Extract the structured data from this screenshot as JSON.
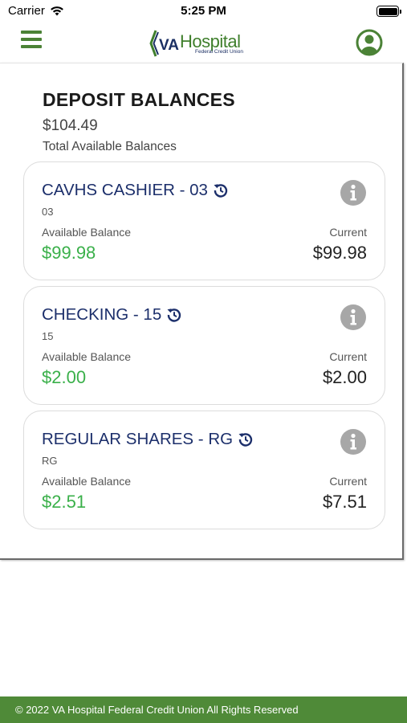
{
  "status_bar": {
    "carrier": "Carrier",
    "time": "5:25 PM"
  },
  "header": {
    "logo_main": "Hospital",
    "logo_badge": "VA",
    "logo_sub": "Federal Credit Union",
    "brand_color": "#4b8236",
    "navy_color": "#1c2f6b"
  },
  "balances": {
    "title": "DEPOSIT BALANCES",
    "total": "$104.49",
    "total_caption": "Total Available Balances"
  },
  "accounts": [
    {
      "name": "CAVHS CASHIER - 03",
      "code": "03",
      "available_label": "Available Balance",
      "available": "$99.98",
      "current_label": "Current",
      "current": "$99.98"
    },
    {
      "name": "CHECKING - 15",
      "code": "15",
      "available_label": "Available Balance",
      "available": "$2.00",
      "current_label": "Current",
      "current": "$2.00"
    },
    {
      "name": "REGULAR SHARES - RG",
      "code": "RG",
      "available_label": "Available Balance",
      "available": "$2.51",
      "current_label": "Current",
      "current": "$7.51"
    }
  ],
  "footer": {
    "copyright": "© 2022 VA Hospital Federal Credit Union All Rights Reserved",
    "color": "#4f8a38"
  },
  "icons": {
    "menu": "hamburger-menu-icon",
    "profile": "user-profile-icon",
    "history": "history-icon",
    "info": "info-icon",
    "wifi": "wifi-icon",
    "battery": "battery-icon"
  }
}
